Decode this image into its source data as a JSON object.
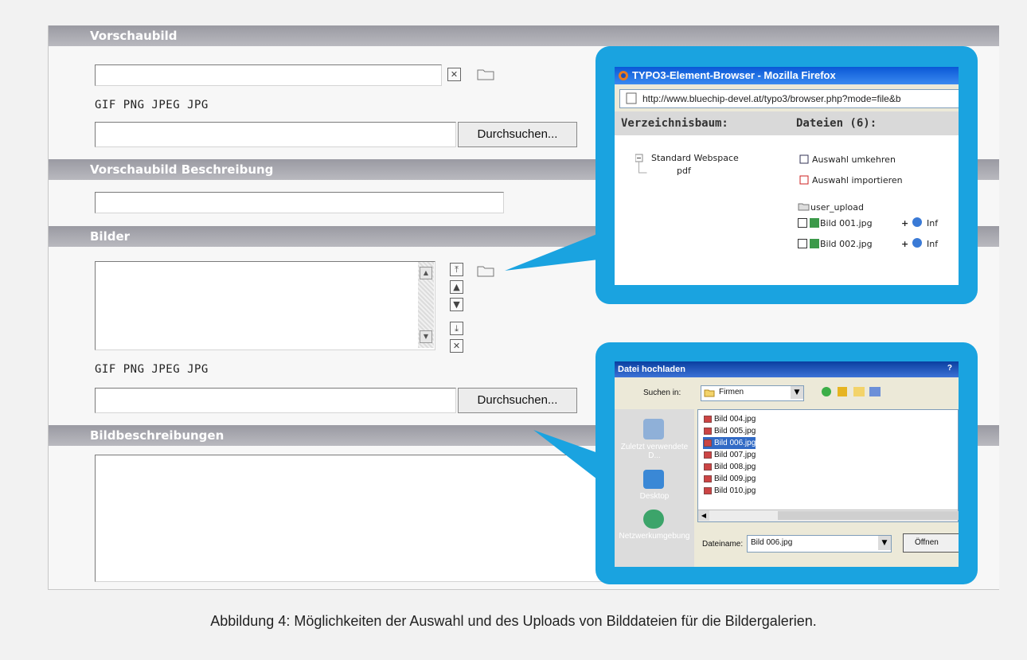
{
  "sections": {
    "preview": {
      "title": "Vorschaubild",
      "formats": "GIF PNG JPEG JPG",
      "browse_label": "Durchsuchen..."
    },
    "preview_desc": {
      "title": "Vorschaubild Beschreibung"
    },
    "images": {
      "title": "Bilder",
      "formats": "GIF PNG JPEG JPG",
      "browse_label": "Durchsuchen..."
    },
    "image_desc": {
      "title": "Bildbeschreibungen"
    }
  },
  "element_browser": {
    "title": "TYPO3-Element-Browser - Mozilla Firefox",
    "url": "http://www.bluechip-devel.at/typo3/browser.php?mode=file&b",
    "tree_header": "Verzeichnisbaum:",
    "files_header": "Dateien (6):",
    "tree": [
      "Standard Webspace",
      "pdf"
    ],
    "actions": [
      "Auswahl umkehren",
      "Auswahl importieren"
    ],
    "folder": "user_upload",
    "files": [
      "Bild 001.jpg",
      "Bild 002.jpg"
    ],
    "info_label": "Inf"
  },
  "upload_dialog": {
    "title": "Datei hochladen",
    "help": "?",
    "look_in_label": "Suchen in:",
    "look_in_value": "Firmen",
    "places": [
      "Zuletzt verwendete D...",
      "Desktop",
      "Netzwerkumgebung"
    ],
    "files": [
      "Bild 004.jpg",
      "Bild 005.jpg",
      "Bild 006.jpg",
      "Bild 007.jpg",
      "Bild 008.jpg",
      "Bild 009.jpg",
      "Bild 010.jpg"
    ],
    "selected_file": "Bild 006.jpg",
    "filename_label": "Dateiname:",
    "filename_value": "Bild 006.jpg",
    "open_label": "Öffnen"
  },
  "caption": "Abbildung 4: Möglichkeiten der Auswahl und des Uploads von Bilddateien für die Bildergalerien.",
  "colors": {
    "section_header": "#a8a8b0",
    "callout": "#1aa3e0",
    "selection": "#316ac5"
  }
}
